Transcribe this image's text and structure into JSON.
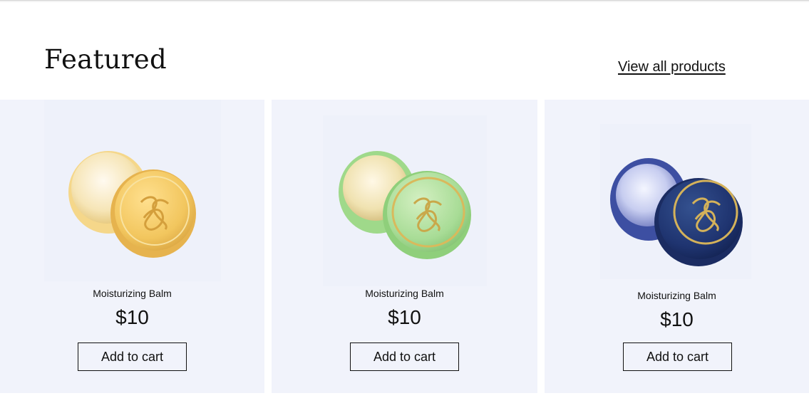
{
  "section": {
    "title": "Featured",
    "view_all_label": "View all products"
  },
  "products": [
    {
      "name": "Moisturizing Balm",
      "price": "$10",
      "button_label": "Add to cart",
      "image": "yellow-balm-tin",
      "color": "#f2cf6e"
    },
    {
      "name": "Moisturizing Balm",
      "price": "$10",
      "button_label": "Add to cart",
      "image": "green-balm-tin",
      "color": "#a8dc96"
    },
    {
      "name": "Moisturizing Balm",
      "price": "$10",
      "button_label": "Add to cart",
      "image": "blue-balm-tin",
      "color": "#1f3470"
    }
  ],
  "colors": {
    "card_background": "#f1f3fb",
    "text": "#111111",
    "gold_accent": "#d4b25a"
  }
}
